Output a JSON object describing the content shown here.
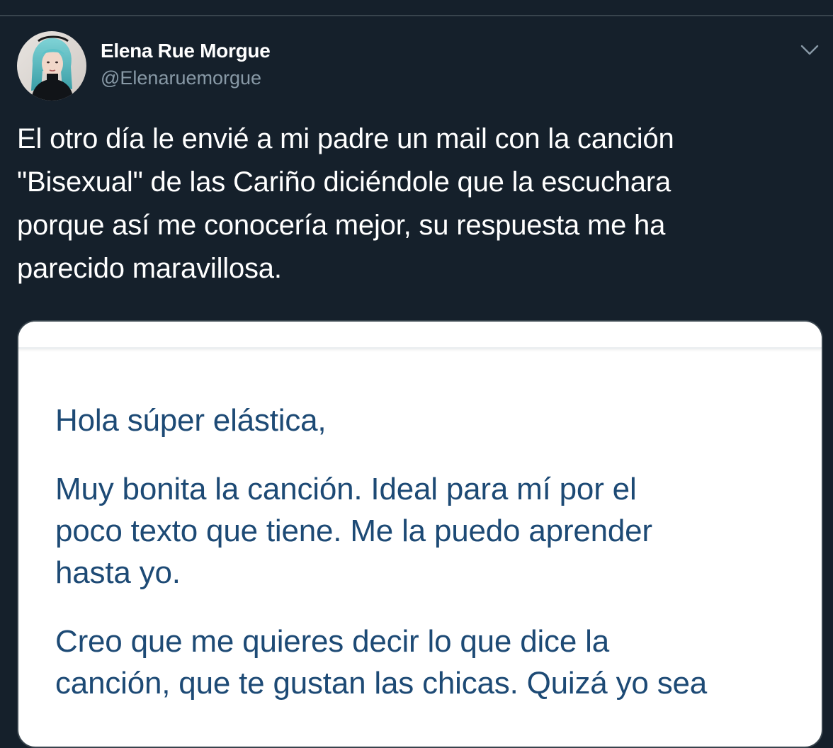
{
  "tweet": {
    "author": {
      "display_name": "Elena Rue Morgue",
      "handle": "@Elenaruemorgue",
      "avatar_icon": "user-avatar-photo"
    },
    "menu_icon": "chevron-down-icon",
    "text_lines": [
      "El otro día le envié a mi padre un mail con la canción",
      "\"Bisexual\" de las Cariño diciéndole que la escuchara",
      "porque así me conocería mejor, su respuesta me ha",
      "parecido maravillosa."
    ],
    "media": {
      "email_paragraphs": [
        [
          "Hola súper elástica,"
        ],
        [
          "Muy bonita la canción. Ideal para mí por el",
          "poco texto que tiene. Me la puedo aprender",
          "hasta yo."
        ],
        [
          "Creo que me quieres decir lo que dice la",
          "canción, que te gustan las chicas. Quizá yo sea"
        ]
      ]
    }
  },
  "colors": {
    "background": "#15202b",
    "divider": "#38444d",
    "primary_text": "#ffffff",
    "secondary_text": "#8899a6",
    "email_text": "#1d4a75"
  }
}
